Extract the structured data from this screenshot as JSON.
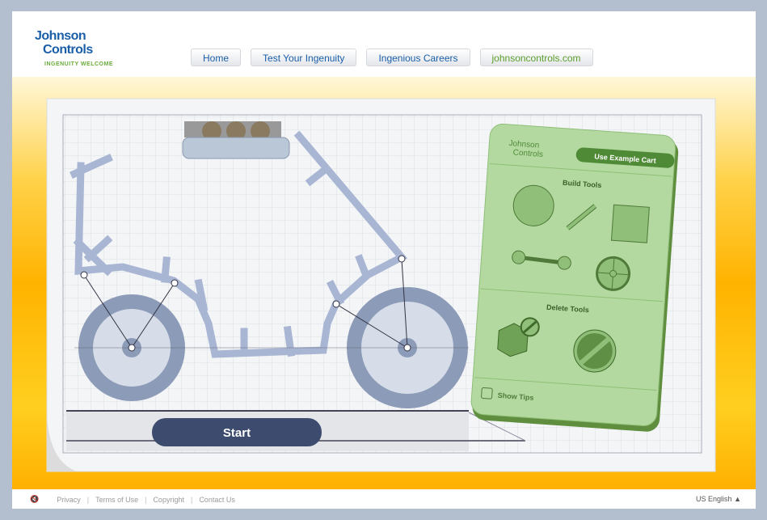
{
  "brand": {
    "line1": "Johnson",
    "line2": "Controls",
    "tagline": "INGENUITY WELCOME"
  },
  "nav": [
    {
      "label": "Home"
    },
    {
      "label": "Test Your Ingenuity"
    },
    {
      "label": "Ingenious Careers"
    },
    {
      "label": "johnsoncontrols.com"
    }
  ],
  "panel": {
    "brand1": "Johnson",
    "brand2": "Controls",
    "example_button": "Use Example Cart",
    "build_title": "Build Tools",
    "delete_title": "Delete Tools",
    "show_tips": "Show Tips",
    "show_tips_checked": false
  },
  "start_button": "Start",
  "footer": {
    "mute_icon": "speaker-mute-icon",
    "links": [
      "Privacy",
      "Terms of Use",
      "Copyright",
      "Contact Us"
    ],
    "language": "US English"
  }
}
